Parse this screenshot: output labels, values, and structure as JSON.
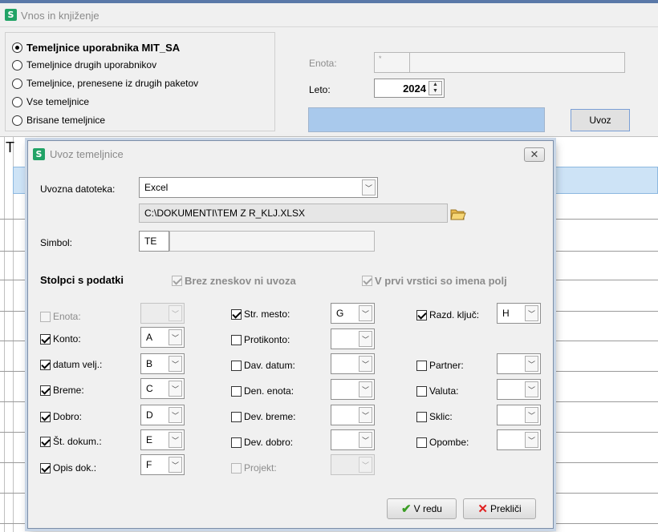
{
  "window": {
    "title": "Vnos in knjiženje",
    "icon": "app-s-icon"
  },
  "filters": {
    "options": [
      {
        "label": "Temeljnice uporabnika MIT_SA",
        "checked": true
      },
      {
        "label": "Temeljnice drugih uporabnikov",
        "checked": false
      },
      {
        "label": "Temeljnice, prenesene iz drugih paketov",
        "checked": false
      },
      {
        "label": "Vse temeljnice",
        "checked": false
      },
      {
        "label": "Brisane temeljnice",
        "checked": false
      }
    ]
  },
  "enota": {
    "label": "Enota:",
    "code": "*",
    "name": ""
  },
  "leto": {
    "label": "Leto:",
    "value": "2024"
  },
  "uvoz_button": "Uvoz",
  "grid": {
    "header_fragment": "T"
  },
  "dialog": {
    "title": "Uvoz temeljnice",
    "close_symbol": "✕",
    "import_file": {
      "label": "Uvozna datoteka:",
      "type": "Excel",
      "path": "C:\\DOKUMENTI\\TEM Z R_KLJ.XLSX"
    },
    "simbol": {
      "label": "Simbol:",
      "code": "TE",
      "name": ""
    },
    "section_title": "Stolpci s podatki",
    "opt_brez": {
      "label": "Brez zneskov ni uvoza",
      "checked": true
    },
    "opt_prvi": {
      "label": "V prvi vrstici so imena polj",
      "checked": true
    },
    "col1": [
      {
        "label": "Enota:",
        "checked": false,
        "disabled": true,
        "value": ""
      },
      {
        "label": "Konto:",
        "checked": true,
        "disabled": false,
        "value": "A"
      },
      {
        "label": "datum velj.:",
        "checked": true,
        "disabled": false,
        "value": "B"
      },
      {
        "label": "Breme:",
        "checked": true,
        "disabled": false,
        "value": "C"
      },
      {
        "label": "Dobro:",
        "checked": true,
        "disabled": false,
        "value": "D"
      },
      {
        "label": "Št. dokum.:",
        "checked": true,
        "disabled": false,
        "value": "E"
      },
      {
        "label": "Opis dok.:",
        "checked": true,
        "disabled": false,
        "value": "F"
      }
    ],
    "col2": [
      {
        "label": "Str. mesto:",
        "checked": true,
        "disabled": false,
        "value": "G"
      },
      {
        "label": "Protikonto:",
        "checked": false,
        "disabled": false,
        "value": ""
      },
      {
        "label": "Dav. datum:",
        "checked": false,
        "disabled": false,
        "value": ""
      },
      {
        "label": "Den. enota:",
        "checked": false,
        "disabled": false,
        "value": ""
      },
      {
        "label": "Dev. breme:",
        "checked": false,
        "disabled": false,
        "value": ""
      },
      {
        "label": "Dev. dobro:",
        "checked": false,
        "disabled": false,
        "value": ""
      },
      {
        "label": "Projekt:",
        "checked": false,
        "disabled": true,
        "value": ""
      }
    ],
    "col3_razd": {
      "label": "Razd. ključ:",
      "checked": true,
      "value": "H"
    },
    "col3": [
      {
        "label": "Partner:",
        "checked": false,
        "value": ""
      },
      {
        "label": "Valuta:",
        "checked": false,
        "value": ""
      },
      {
        "label": "Sklic:",
        "checked": false,
        "value": ""
      },
      {
        "label": "Opombe:",
        "checked": false,
        "value": ""
      }
    ],
    "ok_button": "V redu",
    "cancel_button": "Prekliči"
  }
}
